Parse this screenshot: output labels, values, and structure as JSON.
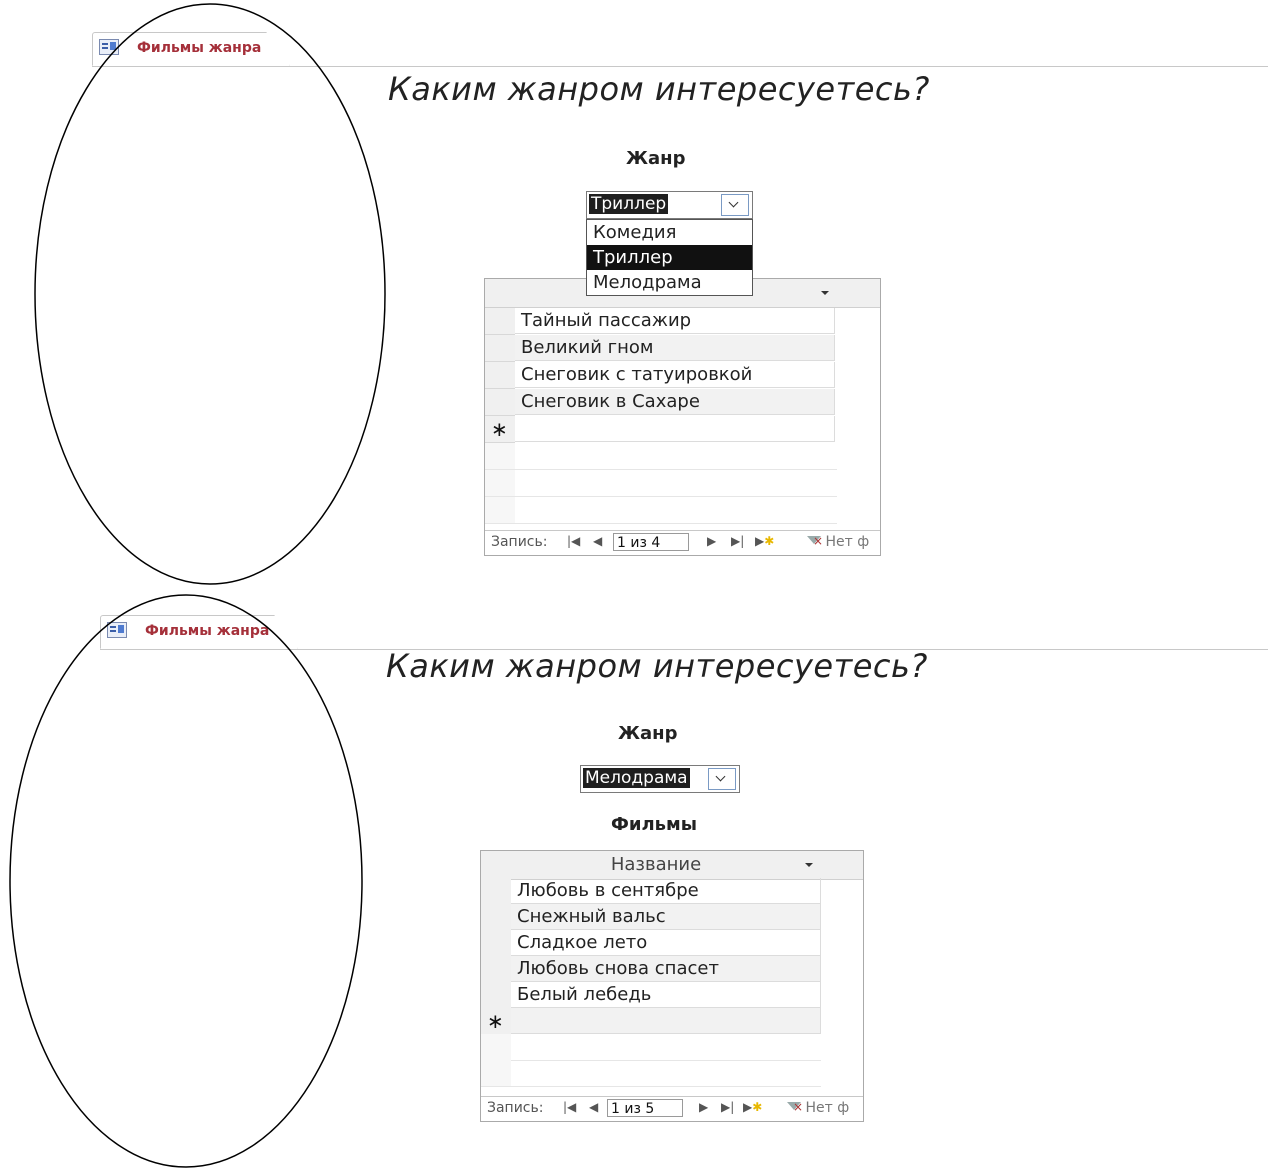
{
  "panels": [
    {
      "tab_label": "Фильмы жанра",
      "heading": "Каким жанром интересуетесь?",
      "genre_label": "Жанр",
      "selected_genre": "Триллер",
      "dropdown_options": [
        "Комедия",
        "Триллер",
        "Мелодрама"
      ],
      "films_label": "",
      "column_header": "",
      "rows": [
        "Тайный пассажир",
        "Великий гном",
        "Снеговик с татуировкой",
        "Снеговик в Сахаре"
      ],
      "nav": {
        "record_label": "Запись:",
        "position": "1 из 4",
        "filter": "Нет ф"
      }
    },
    {
      "tab_label": "Фильмы жанра",
      "heading": "Каким жанром интересуетесь?",
      "genre_label": "Жанр",
      "selected_genre": "Мелодрама",
      "films_label": "Фильмы",
      "column_header": "Название",
      "rows": [
        "Любовь в сентябре",
        "Снежный вальс",
        "Сладкое лето",
        "Любовь снова спасет",
        "Белый лебедь"
      ],
      "nav": {
        "record_label": "Запись:",
        "position": "1 из 5",
        "filter": "Нет ф"
      }
    }
  ],
  "icons": [
    "form-icon",
    "first-record-icon",
    "prev-record-icon",
    "next-record-icon",
    "last-record-icon",
    "new-record-icon",
    "filter-icon",
    "dropdown-arrow-icon"
  ]
}
